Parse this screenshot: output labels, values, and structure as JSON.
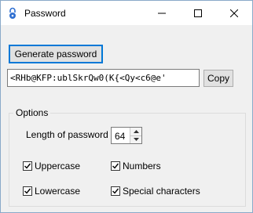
{
  "window": {
    "title": "Password",
    "icon": "lock-icon"
  },
  "actions": {
    "generate_label": "Generate password",
    "copy_label": "Copy"
  },
  "password": {
    "value": "<RHb@KFP:ublSkrQw0(K{<Qy<c6@e'"
  },
  "options": {
    "group_title": "Options",
    "length_label": "Length of password",
    "length_value": "64",
    "uppercase": {
      "label": "Uppercase",
      "checked": true
    },
    "lowercase": {
      "label": "Lowercase",
      "checked": true
    },
    "numbers": {
      "label": "Numbers",
      "checked": true
    },
    "special": {
      "label": "Special characters",
      "checked": true
    }
  },
  "colors": {
    "focus_border": "#0078d7",
    "icon_blue": "#2f6fd1"
  }
}
